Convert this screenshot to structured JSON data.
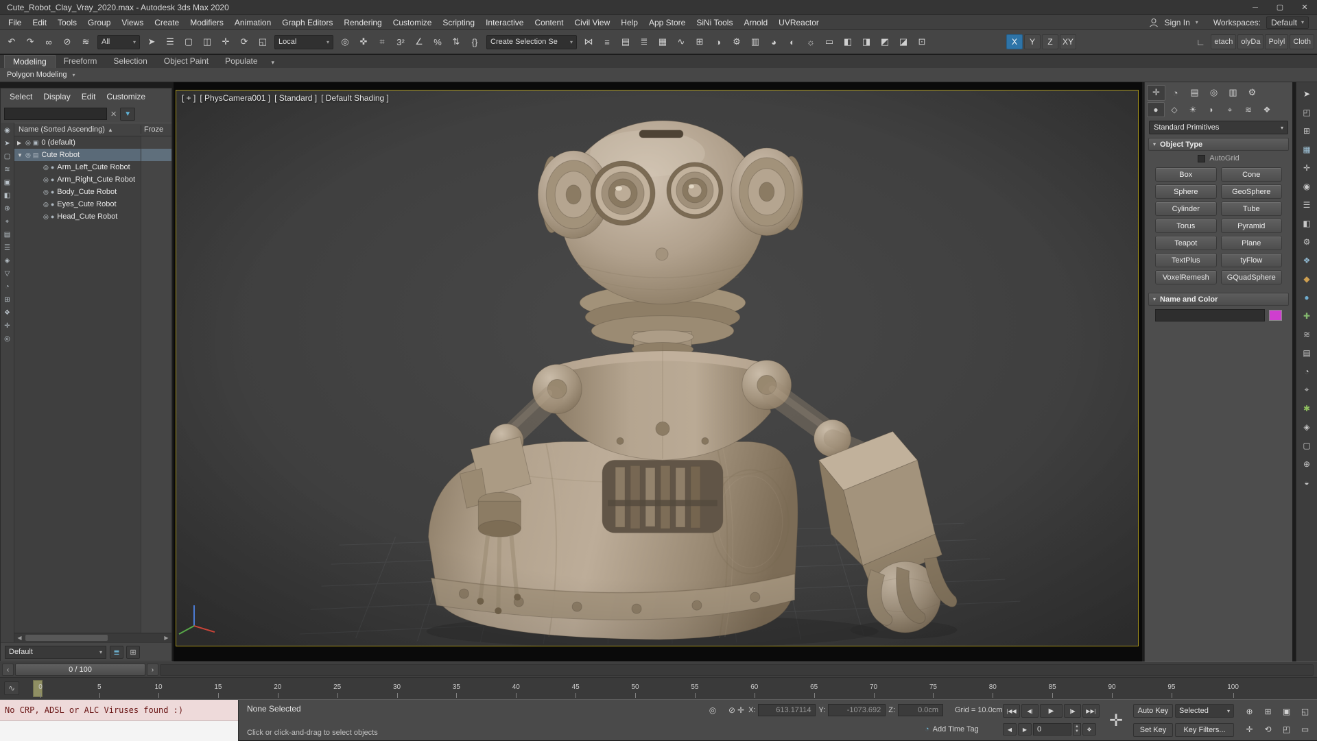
{
  "titlebar": {
    "title": "Cute_Robot_Clay_Vray_2020.max - Autodesk 3ds Max 2020",
    "buttons": [
      {
        "n": "minimize-button",
        "g": "─"
      },
      {
        "n": "restore-button",
        "g": "▢"
      },
      {
        "n": "close-button",
        "g": "✕"
      }
    ]
  },
  "menubar": {
    "items": [
      "File",
      "Edit",
      "Tools",
      "Group",
      "Views",
      "Create",
      "Modifiers",
      "Animation",
      "Graph Editors",
      "Rendering",
      "Customize",
      "Scripting",
      "Interactive",
      "Content",
      "Civil View",
      "Help",
      "App Store",
      "SiNi Tools",
      "Arnold",
      "UVReactor"
    ],
    "sign_in": "Sign In",
    "workspaces_label": "Workspaces:",
    "workspace": "Default"
  },
  "toolbar": {
    "group1": [
      {
        "n": "undo-icon",
        "g": "↶"
      },
      {
        "n": "redo-icon",
        "g": "↷"
      },
      {
        "n": "select-and-link-icon",
        "g": "∞"
      },
      {
        "n": "unlink-selection-icon",
        "g": "⊘"
      },
      {
        "n": "bind-to-space-warp-icon",
        "g": "≋"
      }
    ],
    "filter_dd": "All",
    "group2": [
      {
        "n": "select-object-icon",
        "g": "➤"
      },
      {
        "n": "select-by-name-icon",
        "g": "☰"
      },
      {
        "n": "rectangular-selection-icon",
        "g": "▢"
      },
      {
        "n": "window-crossing-icon",
        "g": "◫"
      },
      {
        "n": "select-and-move-icon",
        "g": "✛"
      },
      {
        "n": "select-and-rotate-icon",
        "g": "⟳"
      },
      {
        "n": "select-and-scale-icon",
        "g": "◱"
      }
    ],
    "coord_dd": "Local",
    "group3": [
      {
        "n": "use-pivot-center-icon",
        "g": "◎"
      },
      {
        "n": "select-and-manipulate-icon",
        "g": "✜"
      },
      {
        "n": "keyboard-override-icon",
        "g": "⌗"
      },
      {
        "n": "snaps-toggle-icon",
        "g": "3²"
      },
      {
        "n": "angle-snap-icon",
        "g": "∠"
      },
      {
        "n": "percent-snap-icon",
        "g": "%"
      },
      {
        "n": "spinner-snap-icon",
        "g": "⇅"
      },
      {
        "n": "named-selection-sets-icon",
        "g": "{}"
      }
    ],
    "sel_set_dd": "Create Selection Se",
    "group4": [
      {
        "n": "mirror-icon",
        "g": "⋈"
      },
      {
        "n": "align-icon",
        "g": "≡"
      },
      {
        "n": "scene-explorer-icon",
        "g": "▤"
      },
      {
        "n": "layer-explorer-icon",
        "g": "≣"
      },
      {
        "n": "ribbon-toggle-icon",
        "g": "▦"
      },
      {
        "n": "curve-editor-icon",
        "g": "∿"
      },
      {
        "n": "schematic-view-icon",
        "g": "⊞"
      },
      {
        "n": "material-editor-icon",
        "g": "◑"
      },
      {
        "n": "render-setup-icon",
        "g": "⚙"
      },
      {
        "n": "rendered-frame-icon",
        "g": "▥"
      },
      {
        "n": "render-production-icon",
        "g": "◕"
      },
      {
        "n": "plugin-icon-1",
        "g": "◐"
      },
      {
        "n": "plugin-icon-2",
        "g": "☼"
      },
      {
        "n": "plugin-icon-3",
        "g": "▭"
      },
      {
        "n": "plugin-icon-4",
        "g": "◧"
      },
      {
        "n": "plugin-icon-5",
        "g": "◨"
      },
      {
        "n": "plugin-icon-6",
        "g": "◩"
      },
      {
        "n": "plugin-icon-7",
        "g": "◪"
      },
      {
        "n": "plugin-icon-8",
        "g": "⊡"
      }
    ],
    "axis": [
      {
        "label": "X",
        "cls": "active"
      },
      {
        "label": "Y",
        "cls": ""
      },
      {
        "label": "Z",
        "cls": ""
      },
      {
        "label": "XY",
        "cls": ""
      }
    ],
    "angle_icon": "∟",
    "truncated": [
      "etach",
      "olyDa",
      "Polyl",
      "Cloth"
    ]
  },
  "ribbon": {
    "tabs": [
      {
        "label": "Modeling",
        "cls": "active"
      },
      {
        "label": "Freeform",
        "cls": ""
      },
      {
        "label": "Selection",
        "cls": ""
      },
      {
        "label": "Object Paint",
        "cls": ""
      },
      {
        "label": "Populate",
        "cls": ""
      }
    ],
    "chevron": "▾",
    "strip": "Polygon Modeling",
    "strip_car": "▾"
  },
  "left_dock": [
    {
      "n": "left-dock-icon-1",
      "g": "◉"
    },
    {
      "n": "left-dock-icon-2",
      "g": "➤"
    },
    {
      "n": "left-dock-icon-3",
      "g": "▢"
    },
    {
      "n": "left-dock-icon-4",
      "g": "≋"
    },
    {
      "n": "left-dock-icon-5",
      "g": "▣"
    },
    {
      "n": "left-dock-icon-6",
      "g": "◧"
    },
    {
      "n": "left-dock-icon-7",
      "g": "⊕"
    },
    {
      "n": "left-dock-icon-8",
      "g": "⌖"
    },
    {
      "n": "left-dock-icon-9",
      "g": "▤"
    },
    {
      "n": "left-dock-icon-10",
      "g": "☰"
    },
    {
      "n": "left-dock-icon-11",
      "g": "◈"
    },
    {
      "n": "left-dock-icon-12",
      "g": "▽"
    },
    {
      "n": "left-dock-icon-13",
      "g": "◔"
    },
    {
      "n": "left-dock-icon-14",
      "g": "⊞"
    },
    {
      "n": "left-dock-icon-15",
      "g": "❖"
    },
    {
      "n": "left-dock-icon-16",
      "g": "✛"
    },
    {
      "n": "left-dock-icon-17",
      "g": "◎"
    }
  ],
  "explorer": {
    "menus": [
      "Select",
      "Display",
      "Edit",
      "Customize"
    ],
    "search_placeholder": "",
    "clear_icon": "✕",
    "funnel_icon": "▼",
    "header_name": "Name (Sorted Ascending)",
    "sort_arrow": "▲",
    "header_frozen": "Froze",
    "rows": [
      {
        "exp": "▶",
        "i1": "◎",
        "i2": "▣",
        "label": "0 (default)",
        "cls": ""
      },
      {
        "exp": "▼",
        "i1": "◎",
        "i2": "▤",
        "label": "Cute Robot",
        "cls": "sel"
      },
      {
        "exp": "",
        "i1": "◎",
        "i2": "●",
        "label": "Arm_Left_Cute Robot",
        "cls": "lvl1"
      },
      {
        "exp": "",
        "i1": "◎",
        "i2": "●",
        "label": "Arm_Right_Cute Robot",
        "cls": "lvl1"
      },
      {
        "exp": "",
        "i1": "◎",
        "i2": "●",
        "label": "Body_Cute Robot",
        "cls": "lvl1"
      },
      {
        "exp": "",
        "i1": "◎",
        "i2": "●",
        "label": "Eyes_Cute Robot",
        "cls": "lvl1"
      },
      {
        "exp": "",
        "i1": "◎",
        "i2": "●",
        "label": "Head_Cute Robot",
        "cls": "lvl1"
      }
    ],
    "hscroll_left": "◀",
    "hscroll_right": "▶",
    "bottom_dropdown": "Default",
    "bottom_icons": [
      {
        "n": "layer-list-icon",
        "g": "≣",
        "cls": "teal"
      },
      {
        "n": "grid-list-icon",
        "g": "⊞",
        "cls": ""
      }
    ]
  },
  "viewport": {
    "labels": [
      "[ + ]",
      "[ PhysCamera001 ]",
      "[ Standard ]",
      "[ Default Shading ]"
    ]
  },
  "command_panel": {
    "tabs1": [
      {
        "n": "create-tab-icon",
        "g": "✛",
        "cls": "active"
      },
      {
        "n": "modify-tab-icon",
        "g": "◔",
        "cls": ""
      },
      {
        "n": "hierarchy-tab-icon",
        "g": "▤",
        "cls": ""
      },
      {
        "n": "motion-tab-icon",
        "g": "◎",
        "cls": ""
      },
      {
        "n": "display-tab-icon",
        "g": "▥",
        "cls": ""
      },
      {
        "n": "utilities-tab-icon",
        "g": "⚙",
        "cls": ""
      }
    ],
    "tabs2": [
      {
        "n": "geometry-icon",
        "g": "●",
        "cls": "active"
      },
      {
        "n": "shapes-icon",
        "g": "◇",
        "cls": ""
      },
      {
        "n": "lights-icon",
        "g": "☀",
        "cls": ""
      },
      {
        "n": "cameras-icon",
        "g": "◗",
        "cls": ""
      },
      {
        "n": "helpers-icon",
        "g": "⌖",
        "cls": ""
      },
      {
        "n": "space-warps-icon",
        "g": "≋",
        "cls": ""
      },
      {
        "n": "systems-icon",
        "g": "❖",
        "cls": ""
      }
    ],
    "category_dd": "Standard Primitives",
    "dd_car": "▾",
    "object_type_title": "Object Type",
    "roll_car": "▾",
    "autogrid": "AutoGrid",
    "buttons": [
      "Box",
      "Cone",
      "Sphere",
      "GeoSphere",
      "Cylinder",
      "Tube",
      "Torus",
      "Pyramid",
      "Teapot",
      "Plane",
      "TextPlus",
      "tyFlow",
      "VoxelRemesh",
      "GQuadSphere"
    ],
    "name_color_title": "Name and Color",
    "color_swatch": "#cf3fcf"
  },
  "right_dock": [
    {
      "n": "right-dock-pointer-icon",
      "g": "➤",
      "c": "#d8d8d8"
    },
    {
      "n": "right-dock-icon-2",
      "g": "◰",
      "c": "#c8c8c8"
    },
    {
      "n": "right-dock-icon-3",
      "g": "⊞",
      "c": "#c8c8c8"
    },
    {
      "n": "right-dock-icon-4",
      "g": "▦",
      "c": "#9fc3d8"
    },
    {
      "n": "right-dock-icon-5",
      "g": "✛",
      "c": "#c8c8c8"
    },
    {
      "n": "right-dock-icon-6",
      "g": "◉",
      "c": "#c8c8c8"
    },
    {
      "n": "right-dock-icon-7",
      "g": "☰",
      "c": "#c8c8c8"
    },
    {
      "n": "right-dock-icon-8",
      "g": "◧",
      "c": "#c8c8c8"
    },
    {
      "n": "right-dock-icon-9",
      "g": "⚙",
      "c": "#c8c8c8"
    },
    {
      "n": "right-dock-icon-10",
      "g": "❖",
      "c": "#8fb7cf"
    },
    {
      "n": "right-dock-icon-11",
      "g": "◆",
      "c": "#cfa050"
    },
    {
      "n": "right-dock-icon-12",
      "g": "●",
      "c": "#6fadd0"
    },
    {
      "n": "right-dock-icon-13",
      "g": "✚",
      "c": "#84b86e"
    },
    {
      "n": "right-dock-icon-14",
      "g": "≋",
      "c": "#c8c8c8"
    },
    {
      "n": "right-dock-icon-15",
      "g": "▤",
      "c": "#c8c8c8"
    },
    {
      "n": "right-dock-icon-16",
      "g": "◔",
      "c": "#c8c8c8"
    },
    {
      "n": "right-dock-icon-17",
      "g": "⌖",
      "c": "#c8c8c8"
    },
    {
      "n": "right-dock-icon-18",
      "g": "✱",
      "c": "#8fbf5f"
    },
    {
      "n": "right-dock-icon-19",
      "g": "◈",
      "c": "#c8c8c8"
    },
    {
      "n": "right-dock-icon-20",
      "g": "▢",
      "c": "#c8c8c8"
    },
    {
      "n": "right-dock-icon-21",
      "g": "⊕",
      "c": "#c8c8c8"
    },
    {
      "n": "right-dock-icon-22",
      "g": "◒",
      "c": "#c8c8c8"
    }
  ],
  "timeline": {
    "prev": "‹",
    "next": "›",
    "slider": "0 / 100",
    "mini_curve_icon": "∿",
    "ticks": [
      "0",
      "5",
      "10",
      "15",
      "20",
      "25",
      "30",
      "35",
      "40",
      "45",
      "50",
      "55",
      "60",
      "65",
      "70",
      "75",
      "80",
      "85",
      "90",
      "95",
      "100"
    ]
  },
  "statusbar": {
    "listener": "No CRP, ADSL or ALC Viruses found :)",
    "status": "None Selected",
    "prompt": "Click or click-and-drag to select objects",
    "toggles": [
      {
        "n": "isolate-selection-icon",
        "g": "◎"
      },
      {
        "n": "selection-lock-icon",
        "g": "⊘"
      }
    ],
    "coord_icon": "✛",
    "x_label": "X:",
    "x_value": "613.17114",
    "y_label": "Y:",
    "y_value": "-1073.692",
    "z_label": "Z:",
    "z_value": "0.0cm",
    "grid": "Grid = 10.0cm",
    "timetag_icon": "◔",
    "timetag": "Add Time Tag",
    "playback": [
      {
        "n": "go-to-start-icon",
        "g": "|◀◀",
        "cls": ""
      },
      {
        "n": "previous-frame-icon",
        "g": "◀|",
        "cls": ""
      },
      {
        "n": "play-icon",
        "g": "▶",
        "cls": "wide"
      },
      {
        "n": "next-frame-icon",
        "g": "|▶",
        "cls": ""
      },
      {
        "n": "go-to-end-icon",
        "g": "▶▶|",
        "cls": ""
      }
    ],
    "step": [
      {
        "n": "previous-key-icon",
        "g": "◀"
      },
      {
        "n": "next-key-icon",
        "g": "▶"
      }
    ],
    "frame": "0",
    "spin_up": "▲",
    "spin_down": "▼",
    "key_mode_icon": "❖",
    "navcross": "✛",
    "auto_key": "Auto Key",
    "selected_dd": "Selected",
    "selected_car": "▾",
    "set_key": "Set Key",
    "key_filters": "Key Filters...",
    "vpnav": [
      {
        "n": "zoom-icon",
        "g": "⊕"
      },
      {
        "n": "zoom-all-icon",
        "g": "⊞"
      },
      {
        "n": "zoom-extents-icon",
        "g": "▣"
      },
      {
        "n": "fov-icon",
        "g": "◱"
      },
      {
        "n": "pan-icon",
        "g": "✛"
      },
      {
        "n": "orbit-icon",
        "g": "⟲"
      },
      {
        "n": "maximize-viewport-icon",
        "g": "◰"
      },
      {
        "n": "region-zoom-icon",
        "g": "▭"
      }
    ]
  }
}
